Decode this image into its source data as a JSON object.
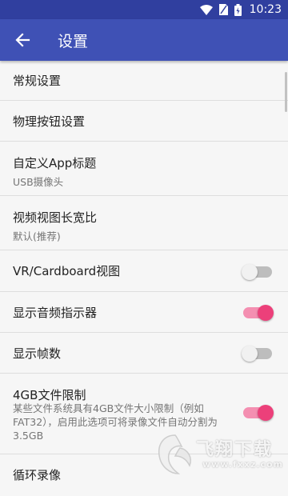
{
  "status_bar": {
    "time": "10:23",
    "icons": [
      "wifi-icon",
      "sim-card-icon",
      "battery-icon"
    ]
  },
  "app_bar": {
    "title": "设置",
    "back_icon": "arrow-back-icon"
  },
  "settings": [
    {
      "title": "常规设置"
    },
    {
      "title": "物理按钮设置"
    },
    {
      "title": "自定义App标题",
      "subtitle": "USB摄像头"
    },
    {
      "title": "视频视图长宽比",
      "subtitle": "默认(推荐)"
    },
    {
      "title": "VR/Cardboard视图",
      "toggle": false
    },
    {
      "title": "显示音频指示器",
      "toggle": true
    },
    {
      "title": "显示帧数",
      "toggle": false
    },
    {
      "title": "4GB文件限制",
      "description": "某些文件系统具有4GB文件大小限制（例如FAT32），启用此选项可将录像文件自动分割为3.5GB",
      "toggle": true
    },
    {
      "title": "循环录像"
    }
  ],
  "watermark": {
    "text": "飞翔下载",
    "url": "www.fxxz.com"
  },
  "colors": {
    "primary": "#3f51b5",
    "primary_dark": "#303f9f",
    "accent": "#ec407a",
    "accent_track": "#f48fb1"
  }
}
